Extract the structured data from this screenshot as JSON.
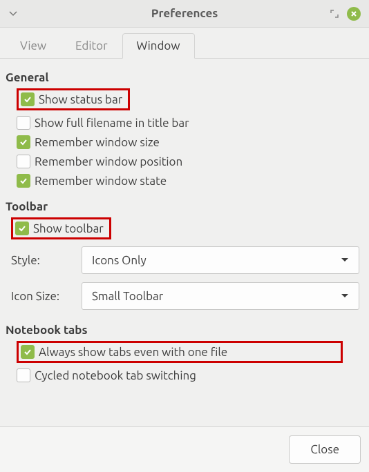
{
  "titlebar": {
    "title": "Preferences"
  },
  "tabs": {
    "view": "View",
    "editor": "Editor",
    "window": "Window"
  },
  "sections": {
    "general": {
      "title": "General",
      "show_status_bar": "Show status bar",
      "show_full_filename": "Show full filename in title bar",
      "remember_window_size": "Remember window size",
      "remember_window_position": "Remember window position",
      "remember_window_state": "Remember window state"
    },
    "toolbar": {
      "title": "Toolbar",
      "show_toolbar": "Show toolbar",
      "style_label": "Style:",
      "style_value": "Icons Only",
      "icon_size_label": "Icon Size:",
      "icon_size_value": "Small Toolbar"
    },
    "notebook": {
      "title": "Notebook tabs",
      "always_show_tabs": "Always show tabs even with one file",
      "cycled_switching": "Cycled notebook tab switching"
    }
  },
  "footer": {
    "close": "Close"
  }
}
